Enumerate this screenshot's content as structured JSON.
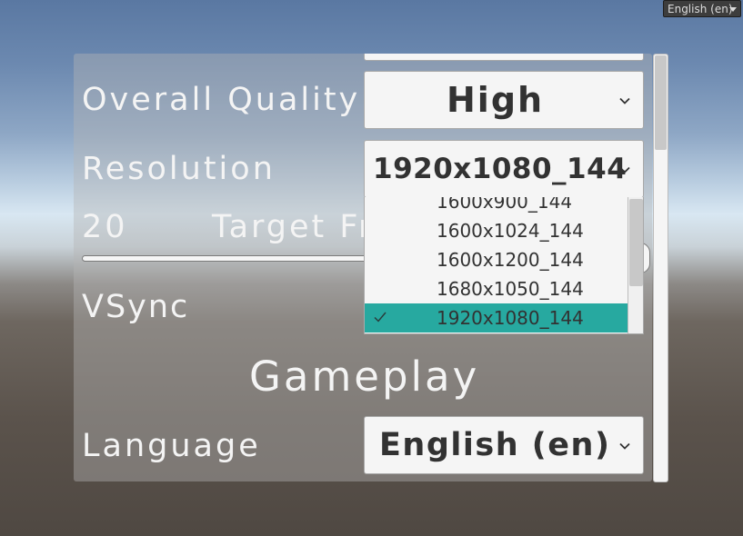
{
  "top_language_dropdown": {
    "value": "English (en)",
    "icon": "caret-down-icon"
  },
  "settings": {
    "overall_quality": {
      "label": "Overall Quality",
      "value": "High"
    },
    "resolution": {
      "label": "Resolution",
      "value": "1920x1080_144",
      "options": [
        "1600x900_144",
        "1600x1024_144",
        "1600x1200_144",
        "1680x1050_144",
        "1920x1080_144"
      ],
      "selected_index": 4
    },
    "target_frame_rate": {
      "value": "20",
      "label": "Target Fr"
    },
    "vsync": {
      "label": "VSync"
    },
    "gameplay_heading": "Gameplay",
    "language": {
      "label": "Language",
      "value": "English (en)"
    }
  },
  "colors": {
    "selected_option": "#27a9a0",
    "label_text": "#f4f4f4",
    "dropdown_text": "#323232"
  }
}
